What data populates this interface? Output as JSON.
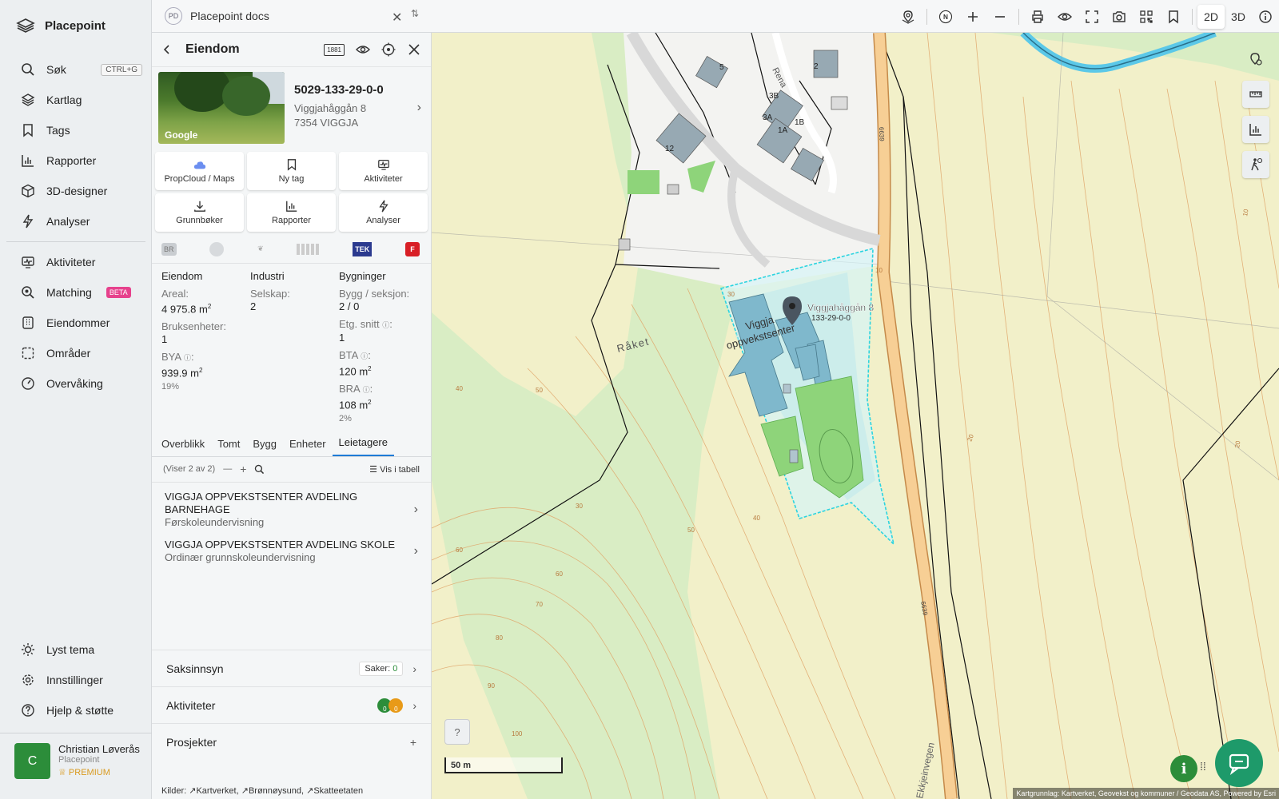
{
  "app": {
    "name": "Placepoint"
  },
  "sidebar": {
    "items": [
      {
        "label": "Søk",
        "icon": "search-icon",
        "shortcut": "CTRL+G"
      },
      {
        "label": "Kartlag",
        "icon": "layers-icon"
      },
      {
        "label": "Tags",
        "icon": "bookmark-icon"
      },
      {
        "label": "Rapporter",
        "icon": "bar-chart-icon"
      },
      {
        "label": "3D-designer",
        "icon": "cube-icon"
      },
      {
        "label": "Analyser",
        "icon": "lightning-icon"
      },
      {
        "label": "Aktiviteter",
        "icon": "monitor-icon"
      },
      {
        "label": "Matching",
        "icon": "search-match-icon",
        "badge": "BETA"
      },
      {
        "label": "Eiendommer",
        "icon": "building-icon"
      },
      {
        "label": "Områder",
        "icon": "area-icon"
      },
      {
        "label": "Overvåking",
        "icon": "gauge-icon"
      }
    ],
    "bottom": [
      {
        "label": "Lyst tema",
        "icon": "sun-icon"
      },
      {
        "label": "Innstillinger",
        "icon": "gear-icon"
      },
      {
        "label": "Hjelp & støtte",
        "icon": "help-icon"
      }
    ],
    "user": {
      "initial": "C",
      "name": "Christian Løverås",
      "org": "Placepoint",
      "plan": "PREMIUM"
    }
  },
  "topbar": {
    "doc_badge": "PD",
    "doc_title": "Placepoint docs",
    "view_2d": "2D",
    "view_3d": "3D",
    "active_view": "2D",
    "compass": "N"
  },
  "panel": {
    "title": "Eiendom",
    "badge_1881": "1881",
    "property": {
      "id": "5029-133-29-0-0",
      "street": "Viggjahåggån 8",
      "postal": "7354 VIGGJA",
      "photo_credit": "Google"
    },
    "actions": [
      {
        "label": "PropCloud / Maps",
        "icon": "cloud-icon"
      },
      {
        "label": "Ny tag",
        "icon": "bookmark-icon"
      },
      {
        "label": "Aktiviteter",
        "icon": "monitor-icon"
      },
      {
        "label": "Grunnbøker",
        "icon": "download-icon"
      },
      {
        "label": "Rapporter",
        "icon": "bar-chart-icon"
      },
      {
        "label": "Analyser",
        "icon": "lightning-icon"
      }
    ],
    "logos": {
      "br": "BR",
      "tek": "TEK",
      "f": "F"
    },
    "facts": {
      "eiendom": {
        "header": "Eiendom",
        "areal_label": "Areal:",
        "areal_value": "4 975.8",
        "areal_unit": "m",
        "bruk_label": "Bruksenheter:",
        "bruk_value": "1",
        "bya_label": "BYA",
        "bya_value": "939.9",
        "bya_unit": "m",
        "bya_pct": "19%"
      },
      "industri": {
        "header": "Industri",
        "selskap_label": "Selskap:",
        "selskap_value": "2"
      },
      "bygninger": {
        "header": "Bygninger",
        "bygg_label": "Bygg / seksjon:",
        "bygg_value": "2 / 0",
        "etg_label": "Etg. snitt",
        "etg_value": "1",
        "bta_label": "BTA",
        "bta_value": "120",
        "bta_unit": "m",
        "bra_label": "BRA",
        "bra_value": "108",
        "bra_unit": "m",
        "bra_pct": "2%"
      }
    },
    "tabs": [
      "Overblikk",
      "Tomt",
      "Bygg",
      "Enheter",
      "Leietagere"
    ],
    "active_tab": "Leietagere",
    "list": {
      "count_text": "(Viser 2 av 2)",
      "table_label": "Vis i tabell"
    },
    "tenants": [
      {
        "name": "VIGGJA OPPVEKSTSENTER AVDELING BARNEHAGE",
        "desc": "Førskoleundervisning"
      },
      {
        "name": "VIGGJA OPPVEKSTSENTER AVDELING SKOLE",
        "desc": "Ordinær grunnskoleundervisning"
      }
    ],
    "sections": {
      "saksinnsyn": "Saksinnsyn",
      "saker_label": "Saker:",
      "saker_count": "0",
      "aktiviteter": "Aktiviteter",
      "aktiviteter_counts": [
        "0",
        "0"
      ],
      "prosjekter": "Prosjekter",
      "plus": "+"
    },
    "sources": {
      "label": "Kilder:",
      "items": [
        "Kartverket,",
        "Brønnøysund,",
        "Skatteetaten"
      ]
    }
  },
  "map": {
    "marker_label": "Viggjahåggån 8",
    "marker_sub": "133-29-0-0",
    "building_label_1": "Viggja",
    "building_label_2": "oppvekstsenter",
    "place_name": "Råket",
    "road_name": "Ekkjeinvegen",
    "road_numbers": [
      "6639",
      "6639"
    ],
    "house_numbers": [
      "5",
      "2",
      "3B",
      "3A",
      "1A",
      "1B",
      "12"
    ],
    "street": "Rena",
    "contours": [
      "10",
      "20",
      "30",
      "40",
      "50",
      "60",
      "70",
      "80",
      "90",
      "100",
      "30",
      "40",
      "50",
      "60",
      "20",
      "10"
    ],
    "scale": "50 m",
    "help": "?",
    "info": "i",
    "attribution": "Kartgrunnlag: Kartverket, Geovekst og kommuner / Geodata AS, Powered by Esri",
    "colors": {
      "parcel": "#2bd4e0",
      "building": "#7fb8cc",
      "green": "#8ed47a",
      "forest": "#d7ecc0"
    }
  }
}
